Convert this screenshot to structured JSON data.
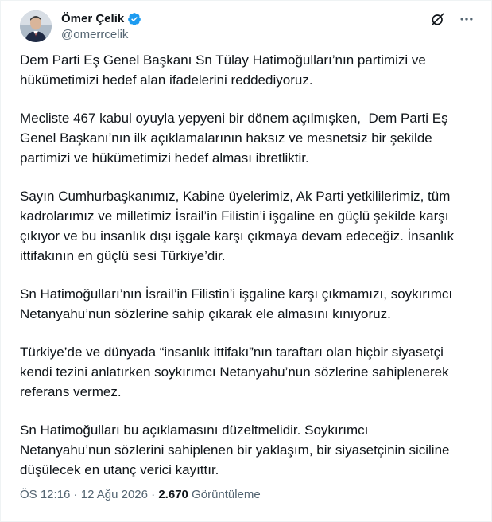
{
  "author": {
    "display_name": "Ömer Çelik",
    "handle": "@omerrcelik",
    "verified_color": "#1d9bf0"
  },
  "header": {
    "grok_icon": "grok-icon",
    "more_icon": "more-icon"
  },
  "tweet": {
    "paragraphs": [
      "Dem Parti Eş Genel Başkanı Sn Tülay Hatimoğulları’nın partimizi ve\nhükümetimizi hedef alan ifadelerini reddediyoruz.",
      "Mecliste 467 kabul oyuyla yepyeni bir dönem açılmışken,  Dem Parti Eş\nGenel Başkanı’nın ilk açıklamalarının haksız ve mesnetsiz bir şekilde\npartimizi ve hükümetimizi hedef alması ibretliktir.",
      "Sayın Cumhurbaşkanımız, Kabine üyelerimiz, Ak Parti yetkililerimiz, tüm\nkadrolarımız ve milletimiz İsrail’in Filistin’i işgaline en güçlü şekilde karşı\nçıkıyor ve bu insanlık dışı işgale karşı çıkmaya devam edeceğiz. İnsanlık\nittifakının en güçlü sesi Türkiye’dir.",
      "Sn Hatimoğulları’nın İsrail’in Filistin’i işgaline karşı çıkmamızı, soykırımcı\nNetanyahu’nun sözlerine sahip çıkarak ele almasını kınıyoruz.",
      "Türkiye’de ve dünyada “insanlık ittifakı”nın taraftarı olan hiçbir siyasetçi\nkendi tezini anlatırken soykırımcı Netanyahu’nun sözlerine sahiplenerek\nreferans vermez.",
      "Sn Hatimoğulları bu açıklamasını düzeltmelidir. Soykırımcı\nNetanyahu’nun sözlerini sahiplenen bir yaklaşım, bir siyasetçinin siciline\ndüşülecek en utanç verici kayıttır."
    ]
  },
  "meta": {
    "time": "ÖS 12:16",
    "separator": " · ",
    "date": "12 Ağu 2026",
    "views_count": "2.670",
    "views_label": " Görüntüleme"
  }
}
